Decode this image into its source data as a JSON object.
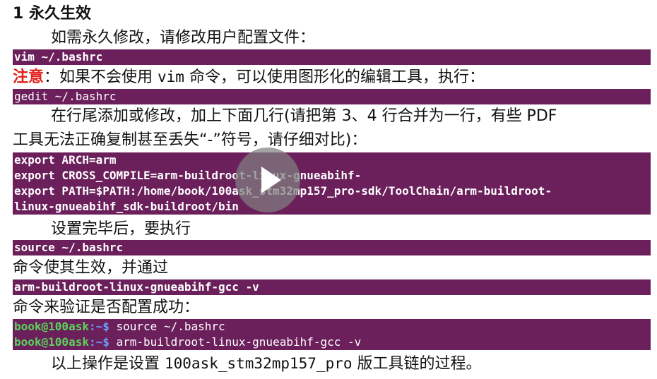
{
  "heading": "1 永久生效",
  "para1": "如需永久修改，请修改用户配置文件：",
  "code1": "vim  ~/.bashrc",
  "note": {
    "label": "注意",
    "text_a": "：如果不会使用 ",
    "text_vim": "vim",
    "text_b": " 命令，可以使用图形化的编辑工具，执行："
  },
  "code2": "gedit ~/.bashrc",
  "para2": {
    "line1": "在行尾添加或修改，加上下面几行(请把第 3、4 行合并为一行，有些 PDF",
    "line2": "工具无法正确复制甚至丢失“-”符号，请仔细对比)："
  },
  "code3": [
    "export ARCH=arm",
    "export CROSS_COMPILE=arm-buildroot-linux-gnueabihf-",
    "export PATH=$PATH:/home/book/100ask_stm32mp157_pro-sdk/ToolChain/arm-buildroot-",
    "linux-gnueabihf_sdk-buildroot/bin"
  ],
  "para3": "设置完毕后，要执行",
  "code4": "source  ~/.bashrc",
  "para4": "命令使其生效，并通过",
  "code5": "arm-buildroot-linux-gnueabihf-gcc -v",
  "para5": "命令来验证是否配置成功：",
  "terminal": [
    {
      "prompt": "book@100ask",
      "path": ":~$",
      "cmd": " source  ~/.bashrc"
    },
    {
      "prompt": "book@100ask",
      "path": ":~$",
      "cmd": " arm-buildroot-linux-gnueabihf-gcc -v"
    }
  ],
  "para6": {
    "a": "以上操作是设置 ",
    "mono": "100ask_stm32mp157_pro",
    "b": " 版工具链的过程。"
  },
  "video": {
    "play_icon": "play-icon"
  }
}
